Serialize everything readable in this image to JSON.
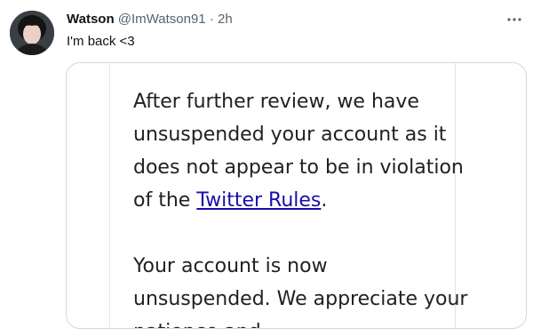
{
  "author": {
    "display_name": "Watson",
    "handle": "@ImWatson91",
    "separator": "·",
    "time": "2h"
  },
  "tweet": {
    "text": "I'm back <3"
  },
  "media": {
    "paragraph1_before_link": "After further review, we have unsuspended your account as it does not appear to be in violation of the ",
    "link_text": "Twitter Rules",
    "paragraph1_after_link": ".",
    "paragraph2": "Your account is now unsuspended. We appreciate your patience and"
  },
  "icons": {
    "more": "more-horizontal-icon",
    "avatar": "avatar"
  },
  "colors": {
    "name": "#0f1419",
    "secondary": "#536471",
    "border": "#cfd9de",
    "link": "#1a0dab"
  }
}
